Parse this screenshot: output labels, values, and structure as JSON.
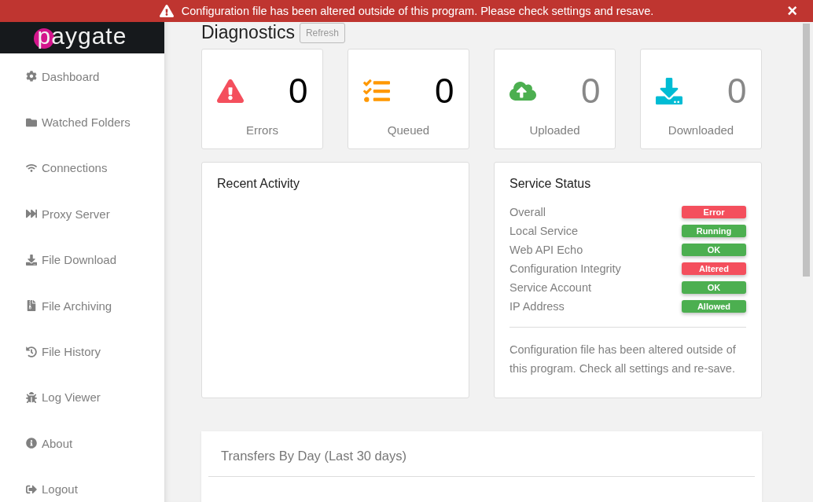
{
  "alert": {
    "message": "Configuration file has been altered outside of this program. Please check settings and resave.",
    "close": "×"
  },
  "logo": {
    "text": "paygate"
  },
  "sidebar": {
    "items": [
      {
        "label": "Dashboard",
        "kind": "gear"
      },
      {
        "label": "Watched Folders",
        "kind": "folder"
      },
      {
        "label": "Connections",
        "kind": "wifi"
      },
      {
        "label": "Proxy Server",
        "kind": "forward"
      },
      {
        "label": "File Download",
        "kind": "download"
      },
      {
        "label": "File Archiving",
        "kind": "archive"
      },
      {
        "label": "File History",
        "kind": "history"
      },
      {
        "label": "Log Viewer",
        "kind": "bug"
      },
      {
        "label": "About",
        "kind": "info"
      },
      {
        "label": "Logout",
        "kind": "logout"
      }
    ]
  },
  "page": {
    "title": "Diagnostics",
    "refresh": "Refresh"
  },
  "stats": [
    {
      "kind": "errors",
      "value": "0",
      "label": "Errors",
      "active": true
    },
    {
      "kind": "queued",
      "value": "0",
      "label": "Queued",
      "active": true
    },
    {
      "kind": "uploaded",
      "value": "0",
      "label": "Uploaded",
      "active": false
    },
    {
      "kind": "downloaded",
      "value": "0",
      "label": "Downloaded",
      "active": false
    }
  ],
  "recent_activity": {
    "title": "Recent Activity"
  },
  "service_status": {
    "title": "Service Status",
    "rows": [
      {
        "label": "Overall",
        "status": "Error",
        "color": "#f44f5d"
      },
      {
        "label": "Local Service",
        "status": "Running",
        "color": "#4caf50"
      },
      {
        "label": "Web API Echo",
        "status": "OK",
        "color": "#4caf50"
      },
      {
        "label": "Configuration Integrity",
        "status": "Altered",
        "color": "#f44f5d"
      },
      {
        "label": "Service Account",
        "status": "OK",
        "color": "#4caf50"
      },
      {
        "label": "IP Address",
        "status": "Allowed",
        "color": "#4caf50"
      }
    ],
    "note": "Configuration file has been altered outside of this program. Check all settings and re-save."
  },
  "transfers": {
    "title": "Transfers By Day (Last 30 days)"
  }
}
